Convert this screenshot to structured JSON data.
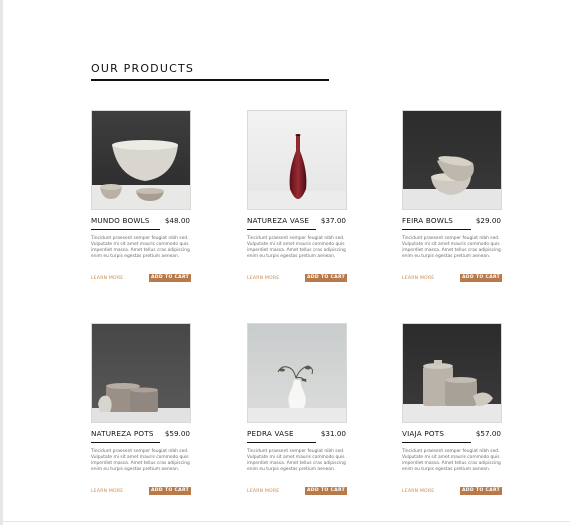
{
  "section": {
    "title": "OUR PRODUCTS"
  },
  "products": [
    {
      "name": "MUNDO BOWLS",
      "price": "$48.00",
      "description": "Tincidunt praesent semper feugiat nibh sed. Vulputate mi sit amet mauris commodo quis imperdiet massa. Amet tellus cras adipiscing enim eu turpis egestas pretium aenean.",
      "learn_more": "LEARN MORE",
      "add_to_cart": "ADD TO CART"
    },
    {
      "name": "NATUREZA VASE",
      "price": "$37.00",
      "description": "Tincidunt praesent semper feugiat nibh sed. Vulputate mi sit amet mauris commodo quis imperdiet massa. Amet tellus cras adipiscing enim eu turpis egestas pretium aenean.",
      "learn_more": "LEARN MORE",
      "add_to_cart": "ADD TO CART"
    },
    {
      "name": "FEIRA BOWLS",
      "price": "$29.00",
      "description": "Tincidunt praesent semper feugiat nibh sed. Vulputate mi sit amet mauris commodo quis imperdiet massa. Amet tellus cras adipiscing enim eu turpis egestas pretium aenean.",
      "learn_more": "LEARN MORE",
      "add_to_cart": "ADD TO CART"
    },
    {
      "name": "NATUREZA POTS",
      "price": "$59.00",
      "description": "Tincidunt praesent semper feugiat nibh sed. Vulputate mi sit amet mauris commodo quis imperdiet massa. Amet tellus cras adipiscing enim eu turpis egestas pretium aenean.",
      "learn_more": "LEARN MORE",
      "add_to_cart": "ADD TO CART"
    },
    {
      "name": "PEDRA VASE",
      "price": "$31.00",
      "description": "Tincidunt praesent semper feugiat nibh sed. Vulputate mi sit amet mauris commodo quis imperdiet massa. Amet tellus cras adipiscing enim eu turpis egestas pretium aenean.",
      "learn_more": "LEARN MORE",
      "add_to_cart": "ADD TO CART"
    },
    {
      "name": "VIAJA POTS",
      "price": "$57.00",
      "description": "Tincidunt praesent semper feugiat nibh sed. Vulputate mi sit amet mauris commodo quis imperdiet massa. Amet tellus cras adipiscing enim eu turpis egestas pretium aenean.",
      "learn_more": "LEARN MORE",
      "add_to_cart": "ADD TO CART"
    }
  ],
  "colors": {
    "accent": "#b87a4a",
    "link": "#c98a4f",
    "text": "#111111",
    "muted": "#6b6b6b"
  }
}
